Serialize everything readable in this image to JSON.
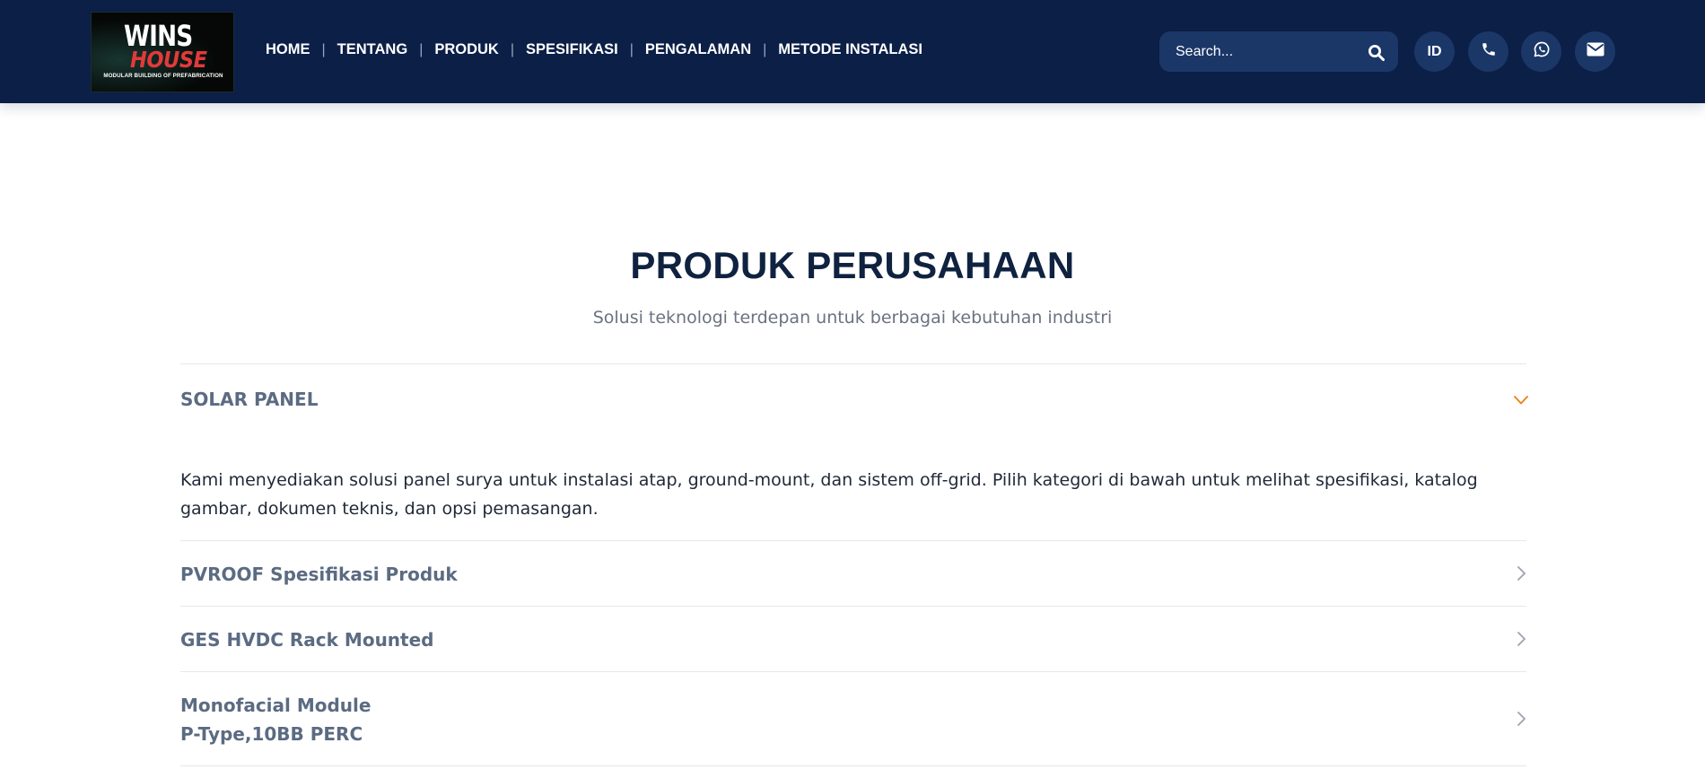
{
  "header": {
    "logo": {
      "line1": "WINS",
      "line2": "HOUSE",
      "tagline": "MODULAR BUILDING OF PREFABRICATION"
    },
    "nav": [
      "HOME",
      "TENTANG",
      "PRODUK",
      "SPESIFIKASI",
      "PENGALAMAN",
      "METODE INSTALASI"
    ],
    "search": {
      "placeholder": "Search..."
    },
    "lang_label": "ID",
    "icons": [
      "search-icon",
      "phone-icon",
      "whatsapp-icon",
      "mail-icon"
    ]
  },
  "main": {
    "title": "PRODUK PERUSAHAAN",
    "subtitle": "Solusi teknologi terdepan untuk berbagai kebutuhan industri",
    "section": {
      "label": "SOLAR PANEL",
      "expanded": true,
      "description": "Kami menyediakan solusi panel surya untuk instalasi atap, ground-mount, dan sistem off-grid. Pilih kategori di bawah untuk melihat spesifikasi, katalog gambar, dokumen teknis, dan opsi pemasangan.",
      "items": [
        {
          "line1": "PVROOF Spesifikasi Produk",
          "line2": ""
        },
        {
          "line1": "GES HVDC Rack Mounted",
          "line2": ""
        },
        {
          "line1": "Monofacial Module",
          "line2": "P-Type,10BB PERC"
        }
      ]
    }
  },
  "colors": {
    "header_bg": "#0b1f47",
    "control_bg": "#1b3768",
    "title": "#0f2240",
    "accent_chevron": "#e8891e",
    "item_text": "#5b6b82"
  }
}
